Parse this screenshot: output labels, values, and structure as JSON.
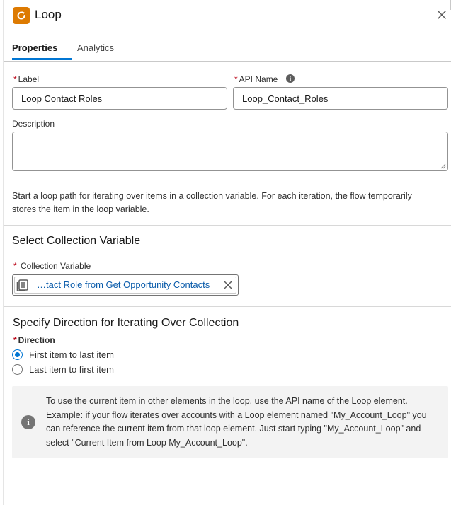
{
  "header": {
    "title": "Loop",
    "icon": "loop-icon",
    "icon_color": "#dd7a01",
    "close_icon": "close-icon"
  },
  "tabs": [
    {
      "label": "Properties",
      "active": true
    },
    {
      "label": "Analytics",
      "active": false
    }
  ],
  "form": {
    "label_field": {
      "required_mark": "*",
      "label": "Label",
      "value": "Loop Contact Roles"
    },
    "api_name_field": {
      "required_mark": "*",
      "label": "API Name",
      "value": "Loop_Contact_Roles",
      "help_icon": "info-icon"
    },
    "description_field": {
      "label": "Description",
      "value": ""
    }
  },
  "intro_text": "Start a loop path for iterating over items in a collection variable. For each iteration, the flow temporarily stores the item in the loop variable.",
  "collection_section": {
    "title": "Select Collection Variable",
    "field_label": "Collection Variable",
    "required_mark": "*",
    "selected_value": "…tact Role from Get Opportunity Contacts",
    "value_icon": "collection-icon"
  },
  "direction_section": {
    "title": "Specify Direction for Iterating Over Collection",
    "field_label": "Direction",
    "required_mark": "*",
    "options": [
      {
        "label": "First item to last item",
        "checked": true
      },
      {
        "label": "Last item to first item",
        "checked": false
      }
    ]
  },
  "info_box": {
    "icon": "info-icon",
    "text": "To use the current item in other elements in the loop, use the API name of the Loop element. Example: if your flow iterates over accounts with a Loop element named \"My_Account_Loop\" you can reference the current item from that loop element. Just start typing \"My_Account_Loop\" and select \"Current Item from Loop My_Account_Loop\"."
  },
  "colors": {
    "brand_blue": "#0176d3",
    "link_blue": "#0b5cab",
    "required_red": "#ba0517"
  }
}
